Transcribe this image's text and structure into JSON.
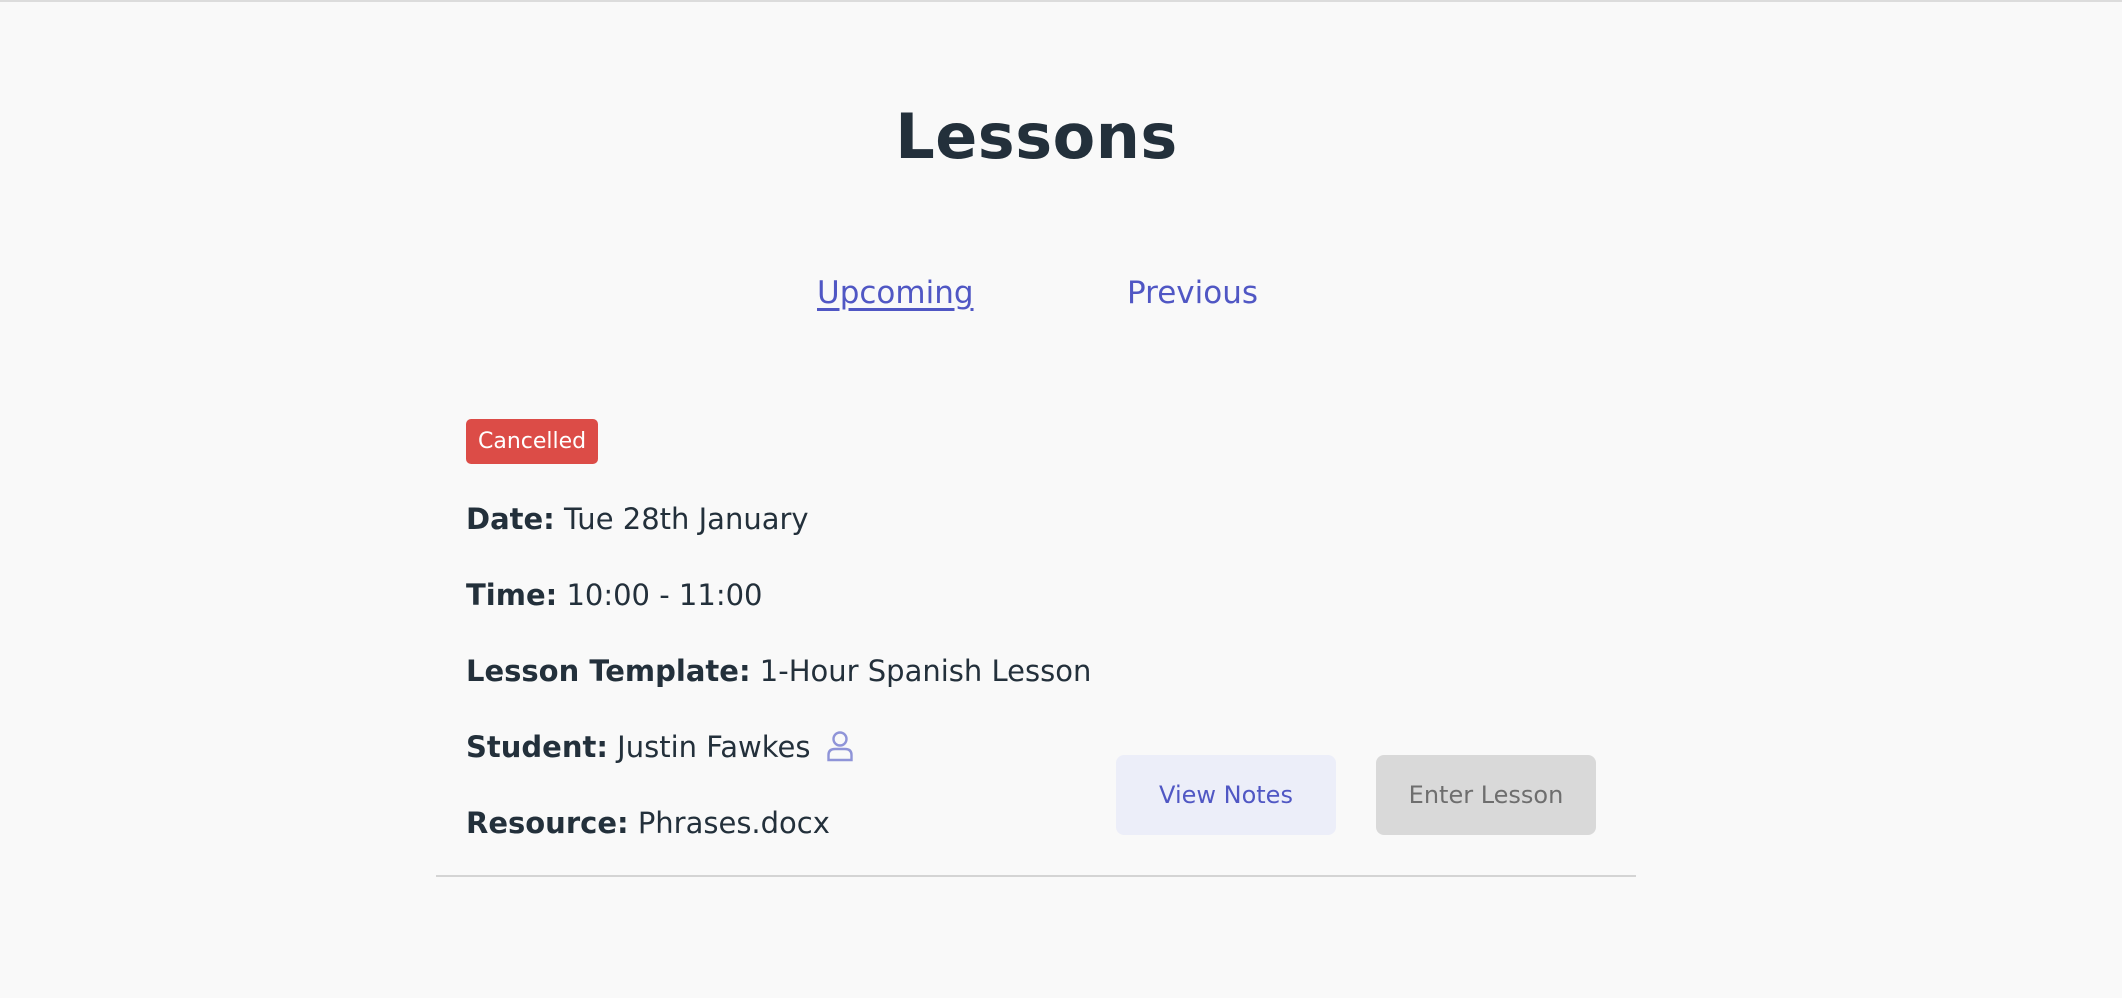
{
  "page": {
    "title": "Lessons"
  },
  "tabs": [
    {
      "label": "Upcoming",
      "active": true
    },
    {
      "label": "Previous",
      "active": false
    }
  ],
  "lesson": {
    "status": "Cancelled",
    "status_color": "#dc4c47",
    "date_label": "Date:",
    "date_value": "Tue 28th January",
    "time_label": "Time:",
    "time_value": "10:00 - 11:00",
    "template_label": "Lesson Template:",
    "template_value": "1-Hour Spanish Lesson",
    "student_label": "Student:",
    "student_value": "Justin Fawkes",
    "student_icon": "user-icon",
    "resource_label": "Resource:",
    "resource_value": "Phrases.docx",
    "view_notes_label": "View Notes",
    "enter_lesson_label": "Enter Lesson"
  },
  "colors": {
    "accent": "#5057c4",
    "text": "#23303b",
    "background": "#f9f9f9"
  }
}
